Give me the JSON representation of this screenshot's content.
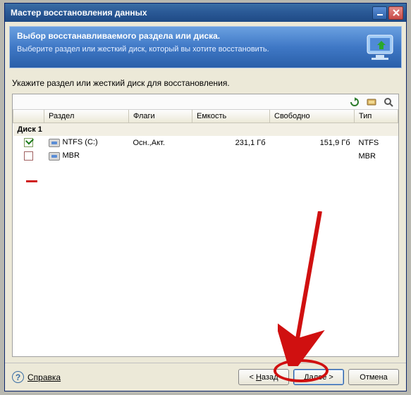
{
  "window_title": "Мастер восстановления данных",
  "banner": {
    "title": "Выбор восстанавливаемого раздела или диска.",
    "subtitle": "Выберите раздел или жесткий диск, который вы хотите восстановить."
  },
  "instruction": "Укажите раздел или жесткий диск для восстановления.",
  "columns": {
    "partition": "Раздел",
    "flags": "Флаги",
    "capacity": "Емкость",
    "free": "Свободно",
    "type": "Тип"
  },
  "group_label": "Диск 1",
  "rows": [
    {
      "checked": true,
      "name": "NTFS (C:)",
      "flags": "Осн.,Акт.",
      "capacity": "231,1 Гб",
      "free": "151,9 Гб",
      "type": "NTFS"
    },
    {
      "checked": false,
      "name": "MBR",
      "flags": "",
      "capacity": "",
      "free": "",
      "type": "MBR"
    }
  ],
  "footer": {
    "help": "Справка",
    "back": "< Назад",
    "next": "Далее >",
    "cancel": "Отмена"
  }
}
